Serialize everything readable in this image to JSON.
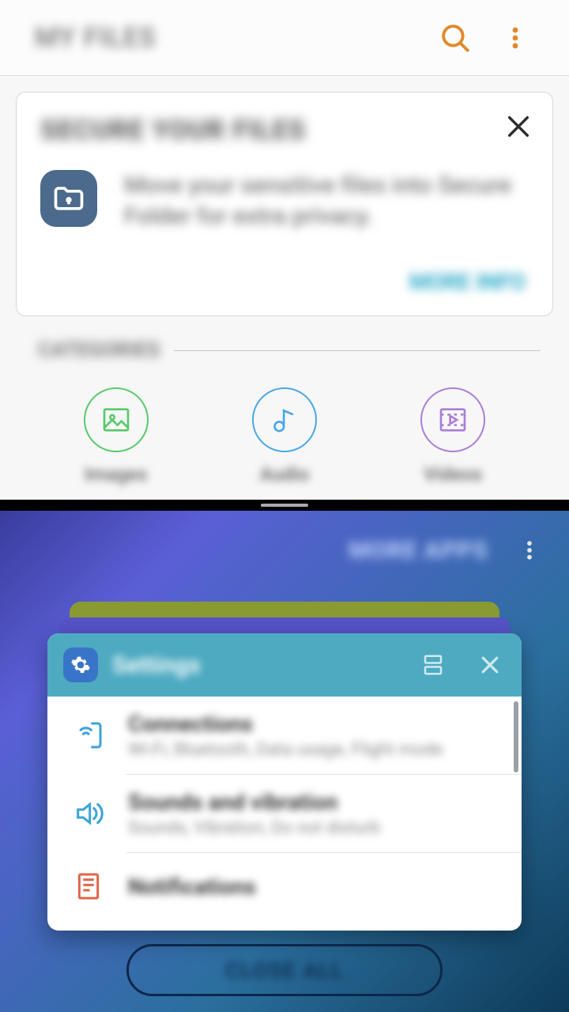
{
  "files": {
    "title": "MY FILES",
    "promo": {
      "title": "SECURE YOUR FILES",
      "desc": "Move your sensitive files into Secure Folder for extra privacy.",
      "action": "MORE INFO"
    },
    "categories_label": "CATEGORIES",
    "categories": [
      {
        "label": "Images"
      },
      {
        "label": "Audio"
      },
      {
        "label": "Videos"
      }
    ]
  },
  "recents": {
    "more_apps": "MORE APPS",
    "close_all": "CLOSE ALL",
    "settings_card": {
      "title": "Settings",
      "rows": [
        {
          "title": "Connections",
          "sub": "Wi-Fi, Bluetooth, Data usage, Flight mode"
        },
        {
          "title": "Sounds and vibration",
          "sub": "Sounds, Vibration, Do not disturb"
        },
        {
          "title": "Notifications",
          "sub": ""
        }
      ]
    }
  }
}
